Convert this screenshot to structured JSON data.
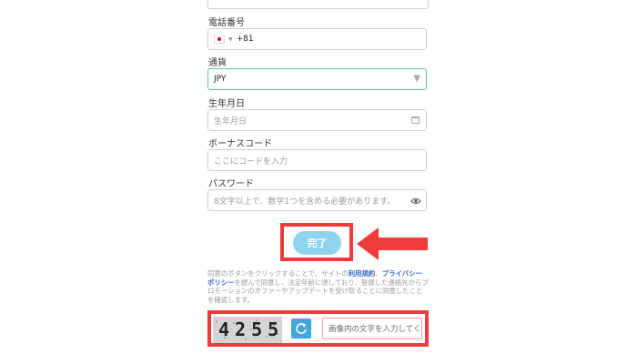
{
  "form": {
    "phone": {
      "label": "電話番号",
      "country_code": "+81"
    },
    "currency": {
      "label": "通貨",
      "value": "JPY"
    },
    "birthdate": {
      "label": "生年月日",
      "placeholder": "生年月日"
    },
    "bonus_code": {
      "label": "ボーナスコード",
      "placeholder": "ここにコードを入力"
    },
    "password": {
      "label": "パスワード",
      "placeholder": "8文字以上で、数字1つを含める必要があります。"
    },
    "submit_label": "完了"
  },
  "terms": {
    "prefix": "同意のボタンをクリックすることで、サイトの",
    "link_terms": "利用規約",
    "separator": "、",
    "link_privacy": "プライバシーポリシー",
    "suffix": "を読んで同意し、法定年齢に達しており、登録した連絡先からプロモーションのオファーやアップデートを受け取ることに同意したことを確認します。"
  },
  "captcha": {
    "image_text": "4255",
    "input_placeholder": "画像内の文字を入力してく"
  },
  "icons": {
    "flag": "japan-flag-icon",
    "dropdown": "chevron-down-icon",
    "calendar": "calendar-icon",
    "eye": "eye-icon",
    "refresh": "refresh-icon",
    "arrow": "red-arrow-left-icon"
  },
  "colors": {
    "accent_border": "#5fbfa7",
    "button_bg": "#8fd3ee",
    "highlight": "#ef3b3b",
    "link": "#3a67c4",
    "refresh_bg": "#43a8d8"
  }
}
